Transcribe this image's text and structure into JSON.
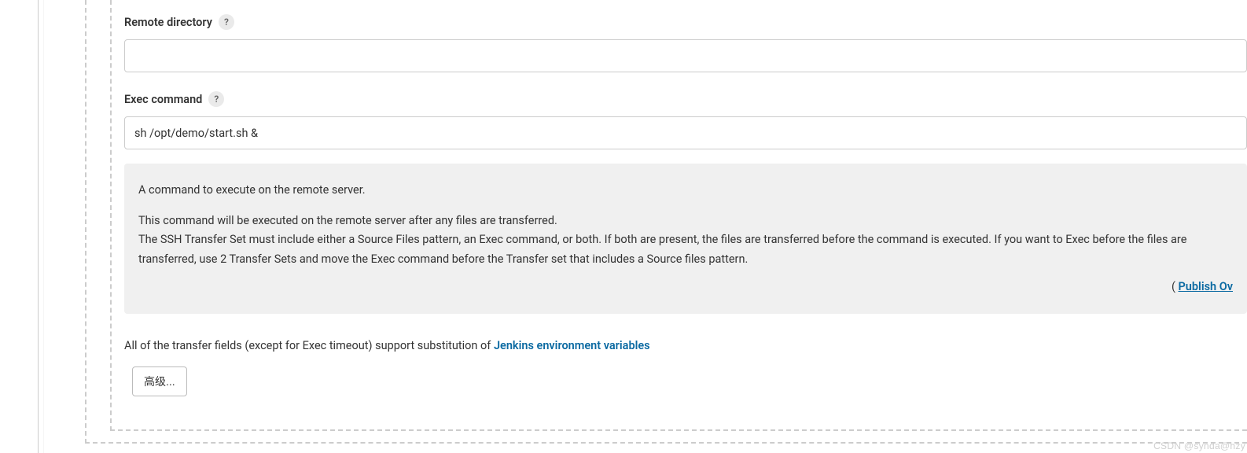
{
  "fields": {
    "remote_directory": {
      "label": "Remote directory",
      "value": ""
    },
    "exec_command": {
      "label": "Exec command",
      "value": "sh /opt/demo/start.sh &"
    }
  },
  "help": {
    "exec_command": {
      "line1": "A command to execute on the remote server.",
      "line2": "This command will be executed on the remote server after any files are transferred.",
      "line3": "The SSH Transfer Set must include either a Source Files pattern, an Exec command, or both. If both are present, the files are transferred before the command is executed. If you want to Exec before the files are transferred, use 2 Transfer Sets and move the Exec command before the Transfer set that includes a Source files pattern."
    },
    "plugin_paren_open": "( ",
    "plugin_link_text": "Publish Ov"
  },
  "substitution": {
    "prefix": "All of the transfer fields (except for Exec timeout) support substitution of ",
    "link_text": "Jenkins environment variables"
  },
  "buttons": {
    "advanced": "高级..."
  },
  "icons": {
    "help": "?"
  },
  "watermark": "CSDN @synda@hzy"
}
